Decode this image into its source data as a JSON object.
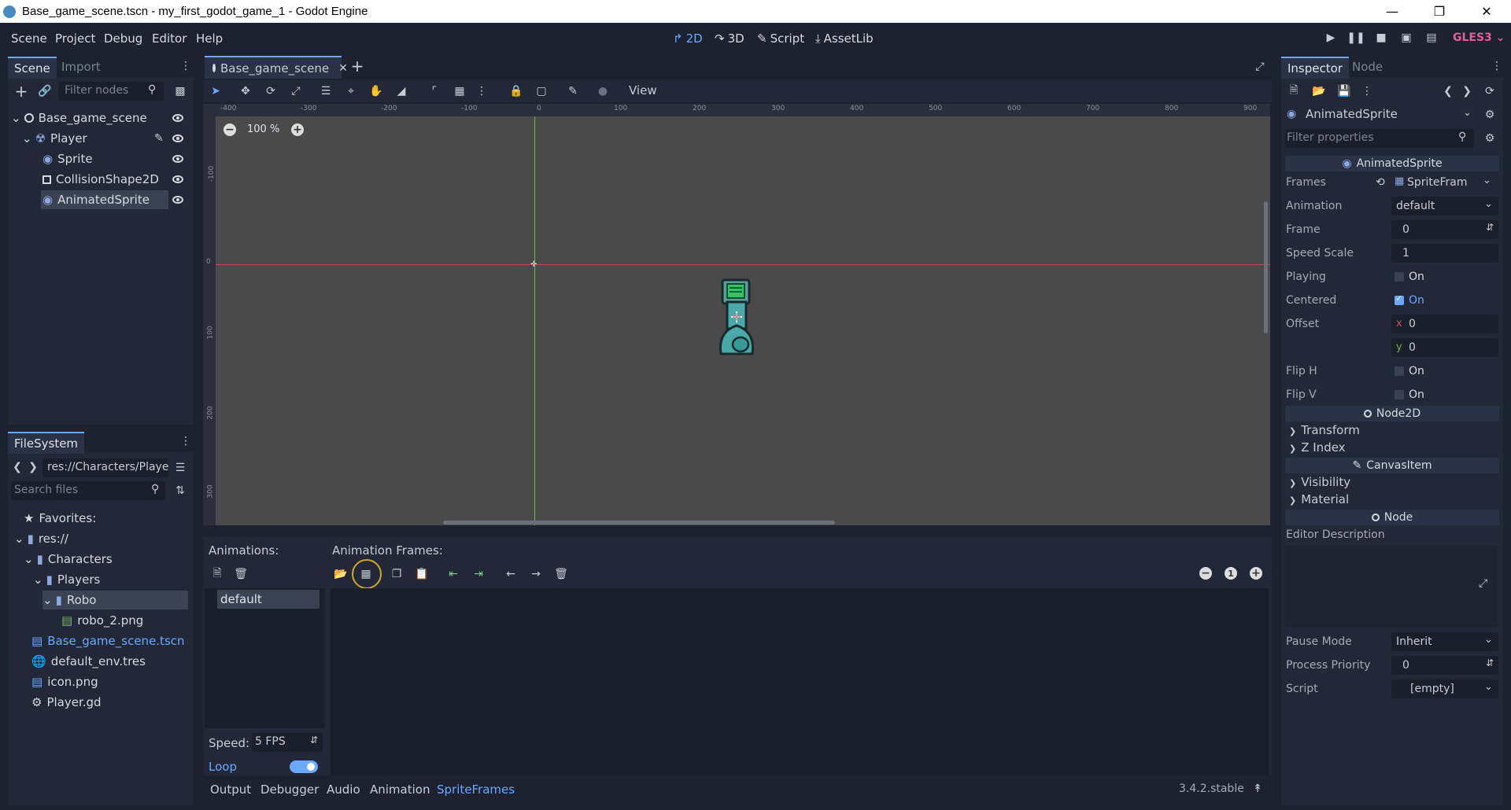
{
  "window": {
    "title": "Base_game_scene.tscn - my_first_godot_game_1 - Godot Engine"
  },
  "menu": {
    "items": [
      "Scene",
      "Project",
      "Debug",
      "Editor",
      "Help"
    ]
  },
  "modes": {
    "2d": "2D",
    "3d": "3D",
    "script": "Script",
    "assetlib": "AssetLib"
  },
  "renderer": "GLES3",
  "scene_dock": {
    "tabs": [
      "Scene",
      "Import"
    ],
    "filter_placeholder": "Filter nodes",
    "tree": [
      "Base_game_scene",
      "Player",
      "Sprite",
      "CollisionShape2D",
      "AnimatedSprite"
    ]
  },
  "filesystem_dock": {
    "title": "FileSystem",
    "path": "res://Characters/Playe",
    "search_placeholder": "Search files",
    "tree": [
      "Favorites:",
      "res://",
      "Characters",
      "Players",
      "Robo",
      "robo_2.png",
      "Base_game_scene.tscn",
      "default_env.tres",
      "icon.png",
      "Player.gd"
    ]
  },
  "editor_tab": {
    "label": "Base_game_scene",
    "view_menu": "View",
    "zoom": "100 %"
  },
  "ruler": {
    "h_ticks": [
      "-400",
      "-300",
      "-200",
      "-100",
      "0",
      "100",
      "200",
      "300",
      "400",
      "500",
      "600",
      "700",
      "800",
      "900"
    ],
    "v_ticks": [
      "-100",
      "0",
      "100",
      "200",
      "300"
    ]
  },
  "spriteframes": {
    "animations_label": "Animations:",
    "frames_label": "Animation Frames:",
    "animation_item": "default",
    "speed_label": "Speed:",
    "speed_value": "5 FPS",
    "loop_label": "Loop"
  },
  "bottom_tabs": [
    "Output",
    "Debugger",
    "Audio",
    "Animation",
    "SpriteFrames"
  ],
  "version": "3.4.2.stable",
  "inspector": {
    "tabs": [
      "Inspector",
      "Node"
    ],
    "object_name": "AnimatedSprite",
    "filter_placeholder": "Filter properties",
    "section_animatedsprite": "AnimatedSprite",
    "props": {
      "frames": {
        "label": "Frames",
        "value": "SpriteFram"
      },
      "animation": {
        "label": "Animation",
        "value": "default"
      },
      "frame": {
        "label": "Frame",
        "value": "0"
      },
      "speed_scale": {
        "label": "Speed Scale",
        "value": "1"
      },
      "playing": {
        "label": "Playing",
        "value": "On"
      },
      "centered": {
        "label": "Centered",
        "value": "On"
      },
      "offset": {
        "label": "Offset",
        "x_label": "x",
        "x": "0",
        "y_label": "y",
        "y": "0"
      },
      "flip_h": {
        "label": "Flip H",
        "value": "On"
      },
      "flip_v": {
        "label": "Flip V",
        "value": "On"
      }
    },
    "section_node2d": "Node2D",
    "node2d_groups": [
      "Transform",
      "Z Index"
    ],
    "section_canvasitem": "CanvasItem",
    "canvas_groups": [
      "Visibility",
      "Material"
    ],
    "section_node": "Node",
    "editor_description": "Editor Description",
    "pause_mode": {
      "label": "Pause Mode",
      "value": "Inherit"
    },
    "process_priority": {
      "label": "Process Priority",
      "value": "0"
    },
    "script": {
      "label": "Script",
      "value": "[empty]"
    }
  },
  "colors": {
    "accent": "#6aa9ff",
    "panel": "#222838",
    "bg": "#1d2230",
    "viewport": "#4a4a4a",
    "renderer": "#e0609b"
  }
}
